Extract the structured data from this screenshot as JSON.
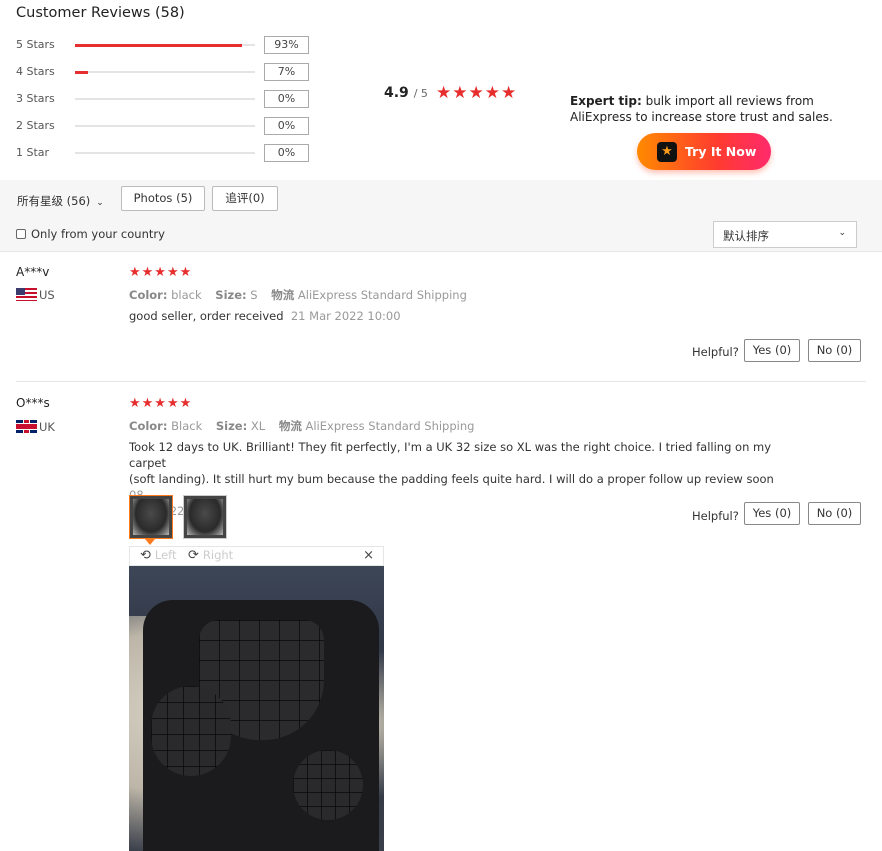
{
  "header": {
    "title": "Customer Reviews (58)"
  },
  "breakdown": [
    {
      "label": "5 Stars",
      "percent": "93%",
      "fraction": 0.93
    },
    {
      "label": "4 Stars",
      "percent": "7%",
      "fraction": 0.07
    },
    {
      "label": "3 Stars",
      "percent": "0%",
      "fraction": 0
    },
    {
      "label": "2 Stars",
      "percent": "0%",
      "fraction": 0
    },
    {
      "label": "1 Star",
      "percent": "0%",
      "fraction": 0
    }
  ],
  "summary": {
    "score": "4.9",
    "out_of": "/ 5",
    "stars": "★★★★★",
    "star_rating": 5
  },
  "expert": {
    "label": "Expert tip:",
    "text": "bulk import all reviews from AliExpress to increase store trust and sales.",
    "button": "Try It Now"
  },
  "filters": {
    "all_ratings": "所有星级 (56)",
    "photos": "Photos (5)",
    "followup": "追评(0)",
    "country_only": "Only from your country",
    "sort": "默认排序"
  },
  "reviews": [
    {
      "name": "A***v",
      "country": "US",
      "stars": "★★★★★",
      "color_label": "Color:",
      "color": "black",
      "size_label": "Size:",
      "size": "S",
      "ship_label": "物流",
      "shipping": "AliExpress Standard Shipping",
      "text": "good seller, order received",
      "date": "21 Mar 2022 10:00",
      "helpful": "Helpful?",
      "yes": "Yes (0)",
      "no": "No (0)"
    },
    {
      "name": "O***s",
      "country": "UK",
      "stars": "★★★★★",
      "color_label": "Color:",
      "color": "Black",
      "size_label": "Size:",
      "size": "XL",
      "ship_label": "物流",
      "shipping": "AliExpress Standard Shipping",
      "text_line1": "Took 12 days to UK. Brilliant! They fit perfectly, I'm a UK 32 size so XL was the right choice. I tried falling on my carpet",
      "text_line2": "(soft landing). It still hurt my bum because the padding feels quite hard. I will do a proper follow up review soon",
      "date_part1": "08",
      "date_part2": "Aug 2022 07:22",
      "helpful": "Helpful?",
      "yes": "Yes (0)",
      "no": "No (0)",
      "viewer": {
        "rotate_left": "Left",
        "rotate_right": "Right",
        "close": "×"
      }
    }
  ],
  "colors": {
    "accent": "#e62e2e",
    "button_orange": "#ff8a00",
    "button_pink": "#ff2a6d"
  }
}
